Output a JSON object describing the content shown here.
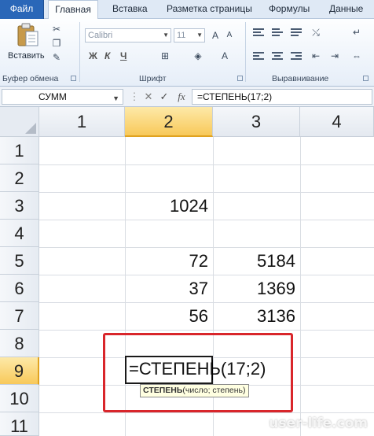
{
  "ribbon": {
    "tabs": [
      {
        "label": "Файл"
      },
      {
        "label": "Главная"
      },
      {
        "label": "Вставка"
      },
      {
        "label": "Разметка страницы"
      },
      {
        "label": "Формулы"
      },
      {
        "label": "Данные"
      }
    ],
    "clipboard": {
      "paste_label": "Вставить",
      "group_label": "Буфер обмена"
    },
    "font": {
      "name": "Calibri",
      "size": "11",
      "bold": "Ж",
      "italic": "К",
      "underline": "Ч",
      "group_label": "Шрифт"
    },
    "alignment": {
      "group_label": "Выравнивание"
    }
  },
  "formula_bar": {
    "name_box": "СУММ",
    "cancel": "✕",
    "enter": "✓",
    "fx": "fx",
    "formula": "=СТЕПЕНЬ(17;2)"
  },
  "sheet": {
    "columns": [
      "1",
      "2",
      "3",
      "4"
    ],
    "rows": [
      "1",
      "2",
      "3",
      "4",
      "5",
      "6",
      "7",
      "8",
      "9",
      "10",
      "11"
    ],
    "cells": {
      "r3c2": "1024",
      "r5c2": "72",
      "r5c3": "5184",
      "r6c2": "37",
      "r6c3": "1369",
      "r7c2": "56",
      "r7c3": "3136"
    },
    "editing_text": "=СТЕПЕНЬ(17;2)",
    "tooltip": {
      "func": "СТЕПЕНЬ",
      "args": "(число; степень)"
    }
  },
  "colors": {
    "highlight": "#d9262b",
    "selected_header": "#f8c95a",
    "file_tab": "#2a67b8"
  },
  "watermark": "user-life.com"
}
